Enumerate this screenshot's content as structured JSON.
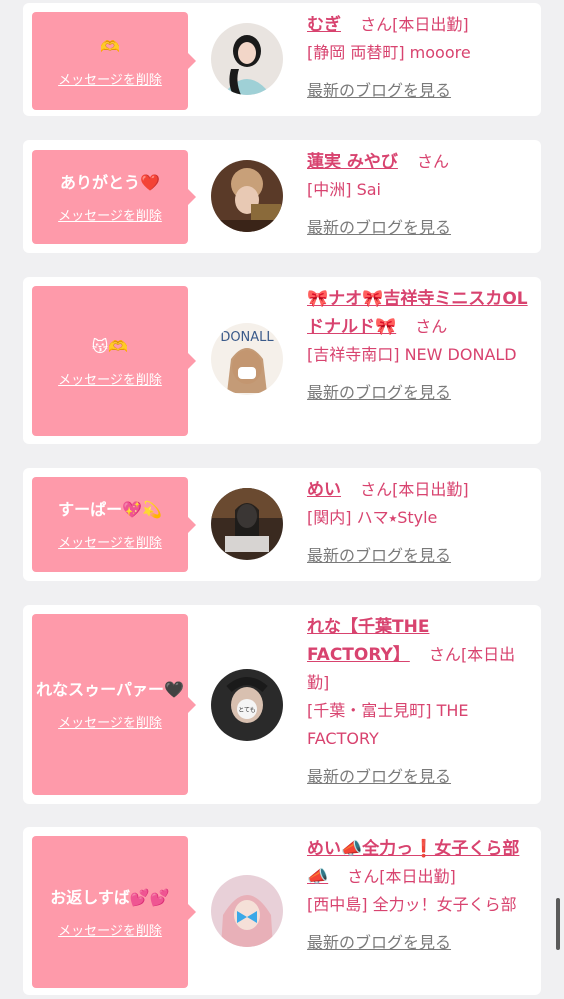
{
  "ui": {
    "delete_label": "メッセージを削除",
    "blog_label": "最新のブログを見る",
    "san": "さん"
  },
  "items": [
    {
      "message": "🫶",
      "name": "むぎ",
      "status": "[本日出勤]",
      "shop": "[静岡 両替町] mooore"
    },
    {
      "message": "ありがとう❤️",
      "name": "蓮実 みやび",
      "status": "",
      "shop": "[中洲] Sai"
    },
    {
      "message": "😽🫶",
      "name": "🎀ナオ🎀吉祥寺ミニスカOLドナルド🎀",
      "status": "",
      "shop": "[吉祥寺南口] NEW DONALD"
    },
    {
      "message": "すーぱー💖💫",
      "name": "めい",
      "status": "[本日出勤]",
      "shop": "[関内] ハマ⭑Style"
    },
    {
      "message": "れなスゥーパァー🖤",
      "name": "れな【千葉THE FACTORY】",
      "status": "[本日出勤]",
      "shop": "[千葉・富士見町] THE FACTORY"
    },
    {
      "message": "お返しすば💕💕",
      "name": "めい📣全力っ❗女子くら部📣",
      "status": "[本日出勤]",
      "shop": "[西中島] 全力ッ！女子くら部"
    }
  ]
}
